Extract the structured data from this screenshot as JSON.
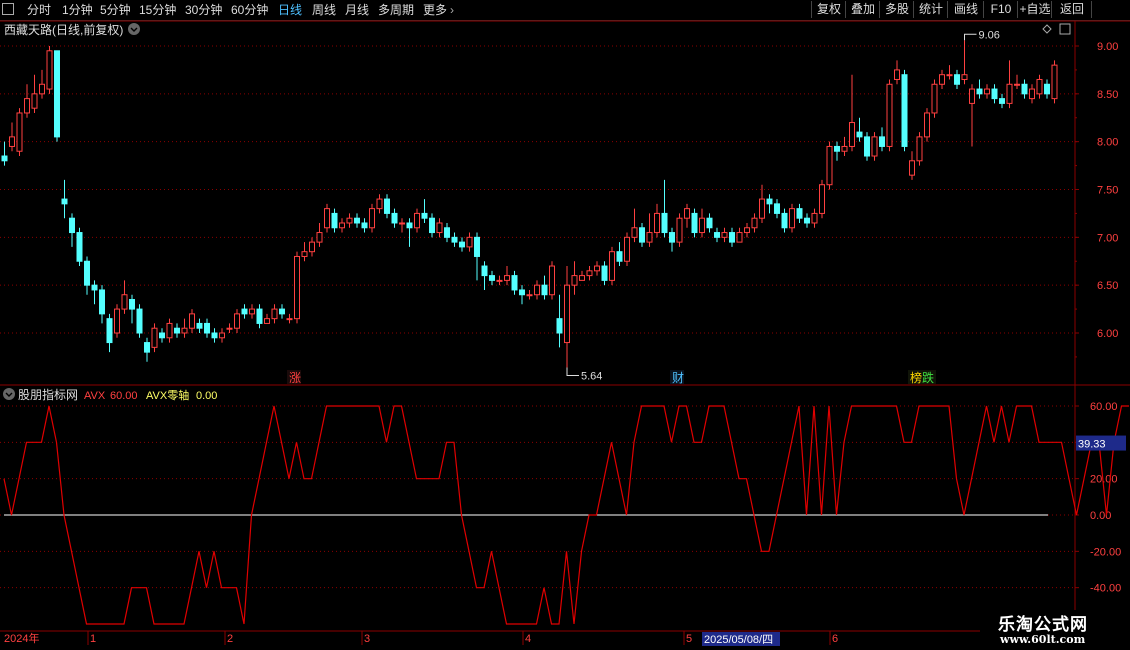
{
  "toolbar": {
    "periods": [
      "分时",
      "1分钟",
      "5分钟",
      "15分钟",
      "30分钟",
      "60分钟",
      "日线",
      "周线",
      "月线",
      "多周期",
      "更多"
    ],
    "active_period": "日线",
    "right_buttons": [
      "复权",
      "叠加",
      "多股",
      "统计",
      "画线",
      "F10",
      "+自选",
      "返回"
    ]
  },
  "main_panel": {
    "title": "西藏天路(日线,前复权)",
    "y_ticks": [
      "9.00",
      "8.50",
      "8.00",
      "7.50",
      "7.00",
      "6.50",
      "6.00"
    ],
    "high_label": "9.06",
    "low_label": "5.64",
    "markers": [
      {
        "text": "涨",
        "color": "#ff4040"
      },
      {
        "text": "财",
        "color": "#4ec0ff"
      },
      {
        "text": "榜",
        "color": "#ffd700"
      },
      {
        "text": "跌",
        "color": "#40e040"
      }
    ]
  },
  "indicator_panel": {
    "name": "股朋指标网",
    "line1_name": "AVX",
    "line1_value": "60.00",
    "line2_name": "AVX零轴",
    "line2_value": "0.00",
    "y_ticks": [
      "60.00",
      "40.00",
      "20.00",
      "0.00",
      "-20.00",
      "-40.00"
    ],
    "current_value": "39.33"
  },
  "time_axis": {
    "labels": [
      "2024年",
      "1",
      "2",
      "3",
      "4",
      "5",
      "6"
    ],
    "cursor_date": "2025/05/08/四"
  },
  "watermark": {
    "line1": "乐淘公式网",
    "line2": "www.60lt.com"
  },
  "colors": {
    "up": "#ff4040",
    "down": "#54ffff",
    "indicator": "#e00000",
    "zero_line": "#ffffff",
    "grid": "#8b0000",
    "axis_text": "#ff4040"
  },
  "chart_data": [
    {
      "type": "candlestick",
      "title": "西藏天路(日线,前复权)",
      "ylim": [
        5.5,
        9.25
      ],
      "y_ticks": [
        6.0,
        6.5,
        7.0,
        7.5,
        8.0,
        8.5,
        9.0
      ],
      "series": [
        {
          "values": [
            [
              7.85,
              7.8,
              8.0,
              7.75
            ],
            [
              7.95,
              8.05,
              8.2,
              7.9
            ],
            [
              7.9,
              8.3,
              8.35,
              7.85
            ],
            [
              8.3,
              8.45,
              8.6,
              8.25
            ],
            [
              8.35,
              8.5,
              8.7,
              8.3
            ],
            [
              8.5,
              8.6,
              8.75,
              8.45
            ],
            [
              8.55,
              8.95,
              9.0,
              8.5
            ],
            [
              8.95,
              8.05,
              8.95,
              8.0
            ],
            [
              7.4,
              7.35,
              7.6,
              7.2
            ],
            [
              7.2,
              7.05,
              7.25,
              6.9
            ],
            [
              7.05,
              6.75,
              7.1,
              6.7
            ],
            [
              6.75,
              6.5,
              6.8,
              6.4
            ],
            [
              6.5,
              6.45,
              6.55,
              6.3
            ],
            [
              6.45,
              6.2,
              6.5,
              6.1
            ],
            [
              6.15,
              5.9,
              6.2,
              5.8
            ],
            [
              6.0,
              6.25,
              6.3,
              5.95
            ],
            [
              6.25,
              6.4,
              6.55,
              6.2
            ],
            [
              6.35,
              6.25,
              6.4,
              6.1
            ],
            [
              6.25,
              6.0,
              6.3,
              5.95
            ],
            [
              5.9,
              5.8,
              5.95,
              5.7
            ],
            [
              5.85,
              6.05,
              6.1,
              5.8
            ],
            [
              6.0,
              5.95,
              6.05,
              5.9
            ],
            [
              5.95,
              6.1,
              6.15,
              5.9
            ],
            [
              6.05,
              6.0,
              6.1,
              5.95
            ],
            [
              6.0,
              6.05,
              6.15,
              5.95
            ],
            [
              6.05,
              6.2,
              6.25,
              6.0
            ],
            [
              6.1,
              6.05,
              6.15,
              6.0
            ],
            [
              6.1,
              6.0,
              6.15,
              5.95
            ],
            [
              6.0,
              5.95,
              6.05,
              5.9
            ],
            [
              5.95,
              6.0,
              6.05,
              5.9
            ],
            [
              6.05,
              6.05,
              6.1,
              6.0
            ],
            [
              6.05,
              6.2,
              6.25,
              6.0
            ],
            [
              6.25,
              6.2,
              6.3,
              6.15
            ],
            [
              6.2,
              6.25,
              6.3,
              6.15
            ],
            [
              6.25,
              6.1,
              6.3,
              6.05
            ],
            [
              6.1,
              6.15,
              6.2,
              6.1
            ],
            [
              6.15,
              6.25,
              6.3,
              6.1
            ],
            [
              6.25,
              6.2,
              6.3,
              6.15
            ],
            [
              6.15,
              6.15,
              6.2,
              6.1
            ],
            [
              6.15,
              6.8,
              6.85,
              6.1
            ],
            [
              6.8,
              6.85,
              6.95,
              6.75
            ],
            [
              6.85,
              6.95,
              7.0,
              6.8
            ],
            [
              6.95,
              7.05,
              7.15,
              6.9
            ],
            [
              7.1,
              7.3,
              7.35,
              7.05
            ],
            [
              7.25,
              7.1,
              7.3,
              7.05
            ],
            [
              7.1,
              7.15,
              7.2,
              7.05
            ],
            [
              7.15,
              7.2,
              7.25,
              7.1
            ],
            [
              7.2,
              7.15,
              7.25,
              7.1
            ],
            [
              7.15,
              7.1,
              7.2,
              7.05
            ],
            [
              7.1,
              7.3,
              7.35,
              7.05
            ],
            [
              7.3,
              7.4,
              7.45,
              7.25
            ],
            [
              7.4,
              7.25,
              7.45,
              7.2
            ],
            [
              7.25,
              7.15,
              7.3,
              7.1
            ],
            [
              7.15,
              7.15,
              7.2,
              7.05
            ],
            [
              7.15,
              7.1,
              7.2,
              6.9
            ],
            [
              7.1,
              7.25,
              7.3,
              7.05
            ],
            [
              7.25,
              7.2,
              7.4,
              7.15
            ],
            [
              7.2,
              7.05,
              7.25,
              7.0
            ],
            [
              7.05,
              7.15,
              7.2,
              7.0
            ],
            [
              7.1,
              7.0,
              7.15,
              6.95
            ],
            [
              7.0,
              6.95,
              7.05,
              6.9
            ],
            [
              6.95,
              6.9,
              7.0,
              6.85
            ],
            [
              6.9,
              7.0,
              7.05,
              6.85
            ],
            [
              7.0,
              6.8,
              7.05,
              6.55
            ],
            [
              6.7,
              6.6,
              6.75,
              6.45
            ],
            [
              6.6,
              6.55,
              6.65,
              6.5
            ],
            [
              6.55,
              6.55,
              6.6,
              6.5
            ],
            [
              6.55,
              6.6,
              6.7,
              6.5
            ],
            [
              6.6,
              6.45,
              6.65,
              6.4
            ],
            [
              6.45,
              6.4,
              6.5,
              6.3
            ],
            [
              6.4,
              6.4,
              6.45,
              6.35
            ],
            [
              6.4,
              6.5,
              6.55,
              6.35
            ],
            [
              6.5,
              6.4,
              6.6,
              6.35
            ],
            [
              6.4,
              6.7,
              6.75,
              6.35
            ],
            [
              6.15,
              6.0,
              6.4,
              5.85
            ],
            [
              5.9,
              6.5,
              6.7,
              5.64
            ],
            [
              6.5,
              6.6,
              6.75,
              6.4
            ],
            [
              6.55,
              6.6,
              6.65,
              6.55
            ],
            [
              6.6,
              6.65,
              6.7,
              6.55
            ],
            [
              6.65,
              6.7,
              6.75,
              6.6
            ],
            [
              6.7,
              6.55,
              6.75,
              6.5
            ],
            [
              6.55,
              6.85,
              6.9,
              6.5
            ],
            [
              6.85,
              6.75,
              6.95,
              6.7
            ],
            [
              6.75,
              7.0,
              7.05,
              6.7
            ],
            [
              7.0,
              7.1,
              7.3,
              6.95
            ],
            [
              7.1,
              6.95,
              7.15,
              6.9
            ],
            [
              6.95,
              7.05,
              7.25,
              6.9
            ],
            [
              7.05,
              7.25,
              7.35,
              7.0
            ],
            [
              7.25,
              7.05,
              7.6,
              7.0
            ],
            [
              7.05,
              6.95,
              7.1,
              6.85
            ],
            [
              6.95,
              7.2,
              7.25,
              6.9
            ],
            [
              7.2,
              7.3,
              7.35,
              7.1
            ],
            [
              7.25,
              7.05,
              7.3,
              7.0
            ],
            [
              7.05,
              7.2,
              7.3,
              7.0
            ],
            [
              7.2,
              7.1,
              7.25,
              7.05
            ],
            [
              7.05,
              7.0,
              7.1,
              6.95
            ],
            [
              7.0,
              7.05,
              7.1,
              6.95
            ],
            [
              7.05,
              6.95,
              7.1,
              6.9
            ],
            [
              6.95,
              7.05,
              7.1,
              6.95
            ],
            [
              7.05,
              7.1,
              7.15,
              7.0
            ],
            [
              7.1,
              7.2,
              7.25,
              7.05
            ],
            [
              7.2,
              7.4,
              7.55,
              7.15
            ],
            [
              7.4,
              7.35,
              7.45,
              7.25
            ],
            [
              7.35,
              7.25,
              7.4,
              7.2
            ],
            [
              7.25,
              7.1,
              7.3,
              7.05
            ],
            [
              7.1,
              7.3,
              7.35,
              7.05
            ],
            [
              7.3,
              7.2,
              7.35,
              7.15
            ],
            [
              7.2,
              7.15,
              7.25,
              7.1
            ],
            [
              7.15,
              7.25,
              7.3,
              7.1
            ],
            [
              7.25,
              7.55,
              7.6,
              7.2
            ],
            [
              7.55,
              7.95,
              8.0,
              7.5
            ],
            [
              7.95,
              7.9,
              8.0,
              7.8
            ],
            [
              7.9,
              7.95,
              8.05,
              7.85
            ],
            [
              7.95,
              8.2,
              8.7,
              7.9
            ],
            [
              8.1,
              8.05,
              8.25,
              8.0
            ],
            [
              8.05,
              7.85,
              8.1,
              7.8
            ],
            [
              7.85,
              8.05,
              8.1,
              7.8
            ],
            [
              8.05,
              7.95,
              8.15,
              7.9
            ],
            [
              7.95,
              8.6,
              8.65,
              7.9
            ],
            [
              8.65,
              8.75,
              8.85,
              8.6
            ],
            [
              8.7,
              7.95,
              8.75,
              7.9
            ],
            [
              7.65,
              7.8,
              7.9,
              7.6
            ],
            [
              7.8,
              8.05,
              8.1,
              7.75
            ],
            [
              8.05,
              8.3,
              8.35,
              8.0
            ],
            [
              8.3,
              8.6,
              8.65,
              8.25
            ],
            [
              8.6,
              8.7,
              8.75,
              8.55
            ],
            [
              8.7,
              8.7,
              8.8,
              8.65
            ],
            [
              8.7,
              8.6,
              8.75,
              8.55
            ],
            [
              8.65,
              8.7,
              9.06,
              8.6
            ],
            [
              8.4,
              8.55,
              8.6,
              7.95
            ],
            [
              8.55,
              8.5,
              8.65,
              8.45
            ],
            [
              8.5,
              8.55,
              8.6,
              8.45
            ],
            [
              8.55,
              8.45,
              8.6,
              8.4
            ],
            [
              8.45,
              8.4,
              8.5,
              8.35
            ],
            [
              8.4,
              8.6,
              8.85,
              8.35
            ],
            [
              8.6,
              8.6,
              8.7,
              8.55
            ],
            [
              8.6,
              8.5,
              8.65,
              8.45
            ],
            [
              8.45,
              8.55,
              8.6,
              8.4
            ],
            [
              8.5,
              8.65,
              8.7,
              8.45
            ],
            [
              8.6,
              8.5,
              8.65,
              8.45
            ],
            [
              8.45,
              8.8,
              8.85,
              8.4
            ]
          ]
        }
      ]
    },
    {
      "type": "line",
      "ylim": [
        -55,
        65
      ],
      "y_ticks": [
        -40,
        -20,
        0,
        20,
        40,
        60
      ],
      "series": [
        {
          "name": "AVX",
          "values": [
            20,
            0,
            20,
            40,
            40,
            40,
            60,
            40,
            0,
            -20,
            -40,
            -60,
            -60,
            -60,
            -60,
            -60,
            -60,
            -40,
            -40,
            -40,
            -60,
            -60,
            -60,
            -60,
            -60,
            -40,
            -20,
            -40,
            -20,
            -40,
            -40,
            -40,
            -60,
            0,
            20,
            40,
            60,
            40,
            20,
            40,
            20,
            20,
            40,
            60,
            60,
            60,
            60,
            60,
            60,
            60,
            60,
            40,
            60,
            60,
            40,
            20,
            20,
            20,
            20,
            40,
            40,
            0,
            -20,
            -40,
            -40,
            -20,
            -40,
            -60,
            -60,
            -60,
            -60,
            -60,
            -40,
            -60,
            -60,
            -20,
            -60,
            -20,
            0,
            0,
            20,
            40,
            20,
            0,
            40,
            60,
            60,
            60,
            60,
            40,
            60,
            60,
            40,
            40,
            60,
            60,
            60,
            40,
            20,
            20,
            0,
            -20,
            -20,
            0,
            20,
            40,
            60,
            0,
            60,
            0,
            60,
            0,
            40,
            60,
            60,
            60,
            60,
            60,
            60,
            60,
            40,
            40,
            60,
            60,
            60,
            60,
            60,
            20,
            0,
            20,
            40,
            60,
            40,
            60,
            40,
            60,
            60,
            60,
            40,
            40,
            40,
            40,
            20,
            0,
            20,
            40,
            40,
            0,
            40,
            60,
            60
          ]
        },
        {
          "name": "AVX零轴",
          "values": [
            0
          ]
        }
      ]
    }
  ]
}
